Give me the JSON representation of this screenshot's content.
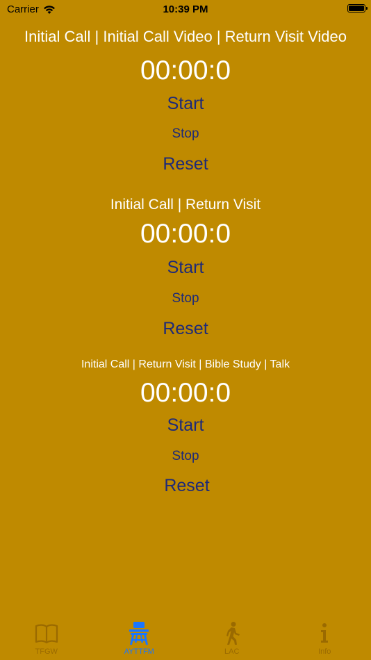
{
  "status_bar": {
    "carrier": "Carrier",
    "time": "10:39 PM"
  },
  "sections": [
    {
      "title": "Initial Call | Initial Call Video | Return Visit Video",
      "timer": "00:00:0",
      "start_label": "Start",
      "stop_label": "Stop",
      "reset_label": "Reset"
    },
    {
      "title": "Initial Call | Return Visit",
      "timer": "00:00:0",
      "start_label": "Start",
      "stop_label": "Stop",
      "reset_label": "Reset"
    },
    {
      "title": "Initial Call | Return Visit | Bible Study | Talk",
      "timer": "00:00:0",
      "start_label": "Start",
      "stop_label": "Stop",
      "reset_label": "Reset"
    }
  ],
  "tab_bar": {
    "tabs": [
      {
        "label": "TFGW",
        "icon": "book-icon",
        "active": false
      },
      {
        "label": "AYTTFM",
        "icon": "desk-icon",
        "active": true
      },
      {
        "label": "LAC",
        "icon": "walking-person-icon",
        "active": false
      },
      {
        "label": "Info",
        "icon": "info-icon",
        "active": false
      }
    ]
  },
  "colors": {
    "background": "#BF8A00",
    "title_text": "#FFFFFF",
    "button_text": "#1E2A78",
    "tab_active": "#1976FF",
    "tab_inactive": "#9A6A00"
  }
}
